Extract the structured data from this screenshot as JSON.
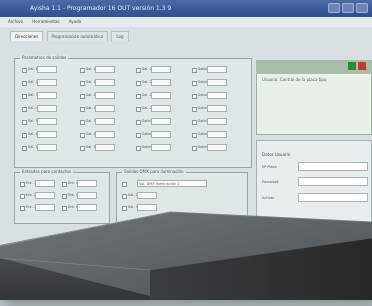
{
  "window": {
    "title": "Ayisha 1.1 - Programador 16 OUT versión 1.3 9"
  },
  "menubar": {
    "items": [
      "Archivo",
      "Herramientas",
      "Ayuda"
    ]
  },
  "tabs": [
    {
      "label": "Direcciones",
      "active": true
    },
    {
      "label": "Programación automática",
      "active": false
    },
    {
      "label": "Log",
      "active": false
    }
  ],
  "groups": {
    "salidas": {
      "legend": "Parámetros de salidas",
      "rows": [
        [
          "Sal. 1",
          "Sal. 11",
          "Sal. 21",
          "Salida 8000"
        ],
        [
          "Sal. 2",
          "Sal. 12",
          "Sal. 22",
          "Salida 8001"
        ],
        [
          "Sal. 3",
          "Sal. 13",
          "Sal. 23",
          "Salida 8002"
        ],
        [
          "Sal. 4",
          "Sal. 14",
          "Sal. 24",
          "Salida 8003"
        ],
        [
          "Sal. 5",
          "Sal. 15",
          "Salida 8010",
          "Salida 8004"
        ],
        [
          "Sal. 6",
          "Sal. 16",
          "Salida 8011",
          "Salida 8005"
        ],
        [
          "Sal. 7",
          "Sal. 17",
          "Salida 8012",
          "Salida 8006"
        ]
      ]
    },
    "entradas": {
      "legend": "Entradas para contactos",
      "rows": [
        [
          "Ent. 1",
          "Ent. 4"
        ],
        [
          "Ent. 2",
          "Ent. 5"
        ],
        [
          "Ent. 3",
          "Ent. 6"
        ]
      ]
    },
    "salidas_dmx": {
      "legend": "Salidas DMX para iluminación",
      "rows": [
        "Sal. DMX Iluminación 1",
        "Sal. 2",
        "Sal. 3"
      ]
    }
  },
  "side": {
    "note": "Usuario: Control de la placa tipo",
    "colors": {
      "green": "#2f8a3a",
      "red": "#c23a2e"
    },
    "form_title": "Datos Usuario",
    "form_rows": [
      "Nº Placa",
      "Password",
      "Activar"
    ],
    "footer": "En esta ventana de parámetros..."
  }
}
